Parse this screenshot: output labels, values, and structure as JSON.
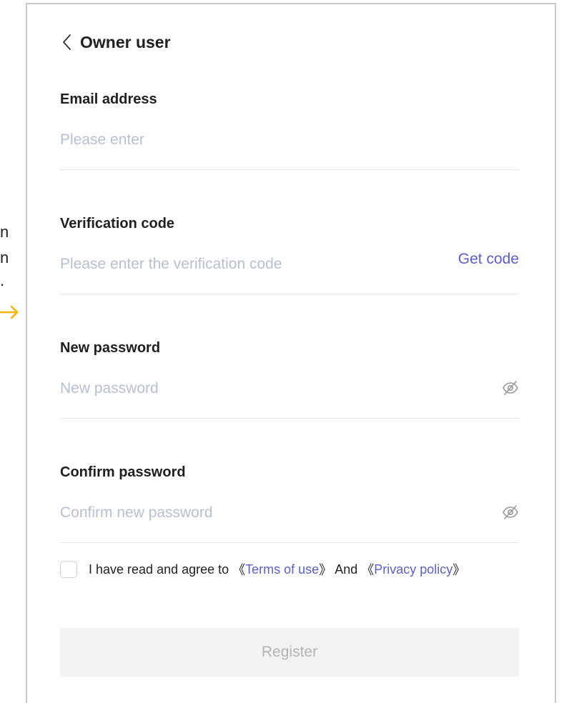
{
  "background_fragments": [
    "n",
    "n",
    "."
  ],
  "header": {
    "title": "Owner user"
  },
  "fields": {
    "email": {
      "label": "Email address",
      "placeholder": "Please enter",
      "value": ""
    },
    "code": {
      "label": "Verification code",
      "placeholder": "Please enter the verification code",
      "value": "",
      "get_code_label": "Get code"
    },
    "new_password": {
      "label": "New password",
      "placeholder": "New password",
      "value": ""
    },
    "confirm_password": {
      "label": "Confirm password",
      "placeholder": "Confirm new password",
      "value": ""
    }
  },
  "agreement": {
    "prefix": "I have read and agree to ",
    "open1": "《",
    "terms": "Terms of use",
    "close1": "》",
    "and": " And ",
    "open2": "《",
    "privacy": "Privacy policy",
    "close2": "》",
    "checked": false
  },
  "register_label": "Register",
  "colors": {
    "accent": "#5a5fd0",
    "placeholder": "#b8bfd0",
    "arrow": "#f5b400",
    "button_bg": "#f2f2f2"
  },
  "icons": {
    "back": "chevron-left-icon",
    "eye": "eye-off-icon",
    "arrow": "arrow-right-icon"
  }
}
